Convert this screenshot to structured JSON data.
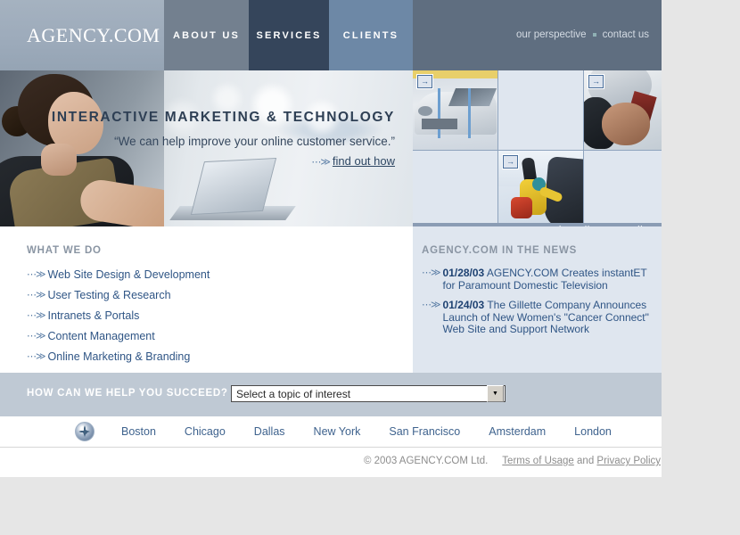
{
  "header": {
    "logo": "AGENCY.COM",
    "nav": [
      {
        "label": "ABOUT US",
        "active": false
      },
      {
        "label": "SERVICES",
        "active": true
      },
      {
        "label": "CLIENTS",
        "active": false
      }
    ],
    "utility_links": [
      {
        "label": "our perspective"
      },
      {
        "label": "contact us"
      }
    ],
    "colors": {
      "logo_panel": "#9dabbb",
      "about": "#73808f",
      "services_active": "#35455b",
      "clients": "#6d88a6",
      "bar": "#5f6e80"
    }
  },
  "hero": {
    "title": "INTERACTIVE MARKETING & TECHNOLOGY",
    "quote": "“We can help improve your online customer service.”",
    "link": "find out how",
    "arrow": "⋯≫"
  },
  "case_studies": {
    "view_all": "view all case studies",
    "thumb_button_icon": "→",
    "cells": [
      {
        "image": "race-car",
        "has_button": true
      },
      {
        "image": "empty",
        "has_button": false
      },
      {
        "image": "driver-face",
        "has_button": true
      },
      {
        "image": "empty",
        "has_button": false
      },
      {
        "image": "mountain-climber",
        "has_button": true
      },
      {
        "image": "empty",
        "has_button": false
      }
    ]
  },
  "what_we_do": {
    "title": "WHAT WE DO",
    "items": [
      {
        "label": "Web Site Design & Development"
      },
      {
        "label": "User Testing & Research"
      },
      {
        "label": "Intranets & Portals"
      },
      {
        "label": "Content Management"
      },
      {
        "label": "Online Marketing & Branding"
      }
    ]
  },
  "news": {
    "title": "AGENCY.COM IN THE NEWS",
    "items": [
      {
        "date": "01/28/03",
        "headline": " AGENCY.COM Creates instantET for Paramount Domestic Television"
      },
      {
        "date": "01/24/03",
        "headline": " The Gillette Company Announces Launch of New Women's \"Cancer Connect\" Web Site and Support Network"
      }
    ]
  },
  "form": {
    "label": "HOW CAN WE HELP YOU SUCCEED?",
    "select_value": "Select a topic of interest"
  },
  "cities": {
    "icon": "compass-icon",
    "items": [
      {
        "label": "Boston"
      },
      {
        "label": "Chicago"
      },
      {
        "label": "Dallas"
      },
      {
        "label": "New York"
      },
      {
        "label": "San Francisco"
      },
      {
        "label": "Amsterdam"
      },
      {
        "label": "London"
      }
    ]
  },
  "footer": {
    "copyright": "© 2003 AGENCY.COM Ltd.",
    "terms": "Terms of Usage",
    "and": "and",
    "privacy": "Privacy Policy"
  }
}
